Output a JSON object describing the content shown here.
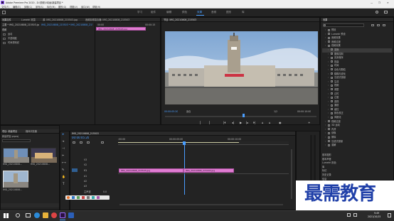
{
  "window": {
    "title": "Adobe Premiere Pro 2020 - D:\\视频\\5动画\\新建项目 *",
    "controls": [
      "—",
      "❐",
      "✕"
    ]
  },
  "menu": [
    "文件(F)",
    "编辑(E)",
    "剪辑(C)",
    "序列(S)",
    "标记(M)",
    "图形(G)",
    "视图(V)",
    "窗口(W)",
    "帮助(H)"
  ],
  "workspaces": [
    "学习",
    "组件",
    "编辑",
    "颜色",
    "效果",
    "音频",
    "图形",
    "库"
  ],
  "active_workspace": "效果",
  "source_panel": {
    "tabs": [
      "效果控件",
      "Lumetri 范围",
      "源: IMG_20210808_215503.jpg",
      "音频剪辑混合器: IMG_20210808_215503"
    ],
    "master_label": "主要 * IMG_20210808_215503.jpg",
    "clip_label": "IMG_20210808_215503 * IMG_20210808_215503.jpg",
    "timecode": "00:00",
    "mini_timecode": "00:00:15",
    "mini_clip": "IMG_20210808_215503.jpg",
    "section": "视频",
    "props": [
      "运动",
      "不透明度",
      "时间重映射"
    ]
  },
  "program_panel": {
    "title": "节目: IMG_20210808_215503",
    "timecode": "00:00:05:20",
    "fit": "适合",
    "zoom": "1/2",
    "duration": "00:00:10:00",
    "playhead_fraction": 0.52
  },
  "effects_panel": {
    "tab": "效果",
    "search_placeholder": "",
    "items": [
      {
        "indent": 1,
        "label": "预设",
        "folder": true
      },
      {
        "indent": 1,
        "label": "Lumetri 预设",
        "folder": true
      },
      {
        "indent": 1,
        "label": "音频效果",
        "folder": true
      },
      {
        "indent": 1,
        "label": "音频过渡",
        "folder": true
      },
      {
        "indent": 1,
        "label": "视频效果",
        "folder": true
      },
      {
        "indent": 2,
        "label": "变换",
        "folder": true
      },
      {
        "indent": 2,
        "label": "图像控制",
        "folder": true
      },
      {
        "indent": 2,
        "label": "实用程序",
        "folder": true
      },
      {
        "indent": 2,
        "label": "扭曲",
        "folder": true
      },
      {
        "indent": 2,
        "label": "时间",
        "folder": true
      },
      {
        "indent": 2,
        "label": "杂色与颗粒",
        "folder": true
      },
      {
        "indent": 2,
        "label": "模糊与锐化",
        "folder": true
      },
      {
        "indent": 2,
        "label": "沉浸式视频",
        "folder": true
      },
      {
        "indent": 2,
        "label": "生成",
        "folder": true
      },
      {
        "indent": 2,
        "label": "视频",
        "folder": true
      },
      {
        "indent": 2,
        "label": "调整",
        "folder": true
      },
      {
        "indent": 2,
        "label": "过时",
        "folder": true
      },
      {
        "indent": 2,
        "label": "过渡",
        "folder": true
      },
      {
        "indent": 2,
        "label": "透视",
        "folder": true
      },
      {
        "indent": 2,
        "label": "通道",
        "folder": true
      },
      {
        "indent": 2,
        "label": "键控",
        "folder": true
      },
      {
        "indent": 2,
        "label": "颜色校正",
        "folder": true
      },
      {
        "indent": 2,
        "label": "风格化",
        "folder": true
      },
      {
        "indent": 1,
        "label": "视频过渡",
        "folder": true
      },
      {
        "indent": 1,
        "label": "3D 运动",
        "folder": true
      },
      {
        "indent": 1,
        "label": "内滑",
        "folder": true
      },
      {
        "indent": 1,
        "label": "划像",
        "folder": true
      },
      {
        "indent": 1,
        "label": "擦除",
        "folder": true
      },
      {
        "indent": 1,
        "label": "沉浸式视频",
        "folder": true
      },
      {
        "indent": 1,
        "label": "溶解",
        "folder": true
      }
    ],
    "footer": [
      "基本图形",
      "基本声音",
      "Lumetri 颜色",
      "库",
      "标记",
      "历史记录",
      "信息"
    ]
  },
  "project_panel": {
    "tabs": [
      "项目: 新建项目",
      "媒体浏览器"
    ],
    "path": "新建项目.prproj",
    "items": [
      "IMG_20210808...",
      "IMG_20210808...",
      "IMG_20210808..."
    ]
  },
  "timeline": {
    "tab": "IMG_20210808_215503",
    "timecode": "00:00:05:20",
    "ruler": [
      ":00:00",
      "00:00:05:00",
      "00:00:10:00"
    ],
    "tracks": [
      "V3",
      "V2",
      "V1",
      "A1",
      "A2",
      "A3"
    ],
    "master": "主声道",
    "master_value": "0.0",
    "clips": [
      {
        "label": "IMG_20210808_215503.jpg"
      },
      {
        "label": "IMG_20210808_215440.jpg"
      }
    ]
  },
  "watermark": "最需教育",
  "taskbar": {
    "time": "9:49",
    "date": "2021/10/15"
  },
  "colors": {
    "accent": "#4a9eff",
    "clip": "#e07cd2",
    "panel": "#232323"
  }
}
